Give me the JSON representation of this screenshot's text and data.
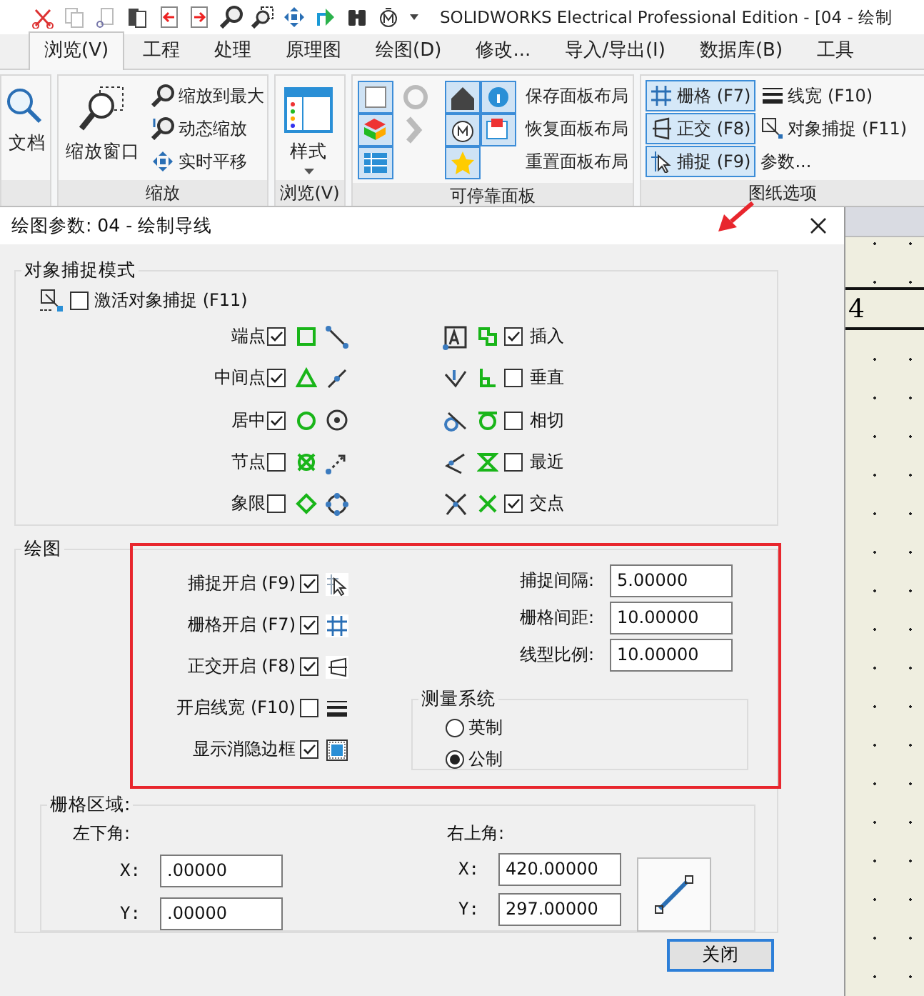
{
  "window": {
    "title": "SOLIDWORKS Electrical Professional Edition - [04 - 绘制"
  },
  "ribbon": {
    "tabs": [
      {
        "label": "浏览(V)",
        "selected": true
      },
      {
        "label": "工程",
        "selected": false
      },
      {
        "label": "处理",
        "selected": false
      },
      {
        "label": "原理图",
        "selected": false
      },
      {
        "label": "绘图(D)",
        "selected": false
      },
      {
        "label": "修改...",
        "selected": false
      },
      {
        "label": "导入/导出(I)",
        "selected": false
      },
      {
        "label": "数据库(B)",
        "selected": false
      },
      {
        "label": "工具",
        "selected": false
      }
    ],
    "groups": [
      {
        "items": [
          {
            "kind": "large",
            "label": "文档"
          }
        ]
      },
      {
        "label": "缩放",
        "items": [
          {
            "kind": "large",
            "label": "缩放窗口"
          },
          {
            "kind": "small",
            "label": "缩放到最大"
          },
          {
            "kind": "small",
            "label": "动态缩放"
          },
          {
            "kind": "small",
            "label": "实时平移"
          }
        ]
      },
      {
        "label": "浏览(V)",
        "items": [
          {
            "kind": "large",
            "label": "样式",
            "dropdown": true
          }
        ]
      },
      {
        "label": "可停靠面板",
        "items": [
          {
            "kind": "icon_grid"
          },
          {
            "kind": "small",
            "label": "保存面板布局"
          },
          {
            "kind": "small",
            "label": "恢复面板布局"
          },
          {
            "kind": "small",
            "label": "重置面板布局"
          }
        ]
      },
      {
        "label": "图纸选项",
        "items": [
          {
            "kind": "toggle",
            "label": "栅格 (F7)",
            "on": true
          },
          {
            "kind": "toggle",
            "label": "正交 (F8)",
            "on": true
          },
          {
            "kind": "toggle",
            "label": "捕捉 (F9)",
            "on": true
          },
          {
            "kind": "small",
            "label": "线宽 (F10)"
          },
          {
            "kind": "small",
            "label": "对象捕捉 (F11)"
          },
          {
            "kind": "small",
            "label": "参数..."
          }
        ]
      }
    ]
  },
  "dialog": {
    "title": "绘图参数: 04 - 绘制导线",
    "object_snap": {
      "title": "对象捕捉模式",
      "activate": {
        "label": "激活对象捕捉 (F11)",
        "checked": false
      },
      "left_modes": [
        {
          "label": "端点",
          "checked": true
        },
        {
          "label": "中间点",
          "checked": true
        },
        {
          "label": "居中",
          "checked": true
        },
        {
          "label": "节点",
          "checked": false
        },
        {
          "label": "象限",
          "checked": false
        }
      ],
      "right_modes": [
        {
          "label": "插入",
          "checked": true
        },
        {
          "label": "垂直",
          "checked": false
        },
        {
          "label": "相切",
          "checked": false
        },
        {
          "label": "最近",
          "checked": false
        },
        {
          "label": "交点",
          "checked": true
        }
      ]
    },
    "drawing": {
      "title": "绘图",
      "toggles": [
        {
          "label": "捕捉开启 (F9)",
          "checked": true
        },
        {
          "label": "栅格开启 (F7)",
          "checked": true
        },
        {
          "label": "正交开启 (F8)",
          "checked": true
        },
        {
          "label": "开启线宽 (F10)",
          "checked": false
        },
        {
          "label": "显示消隐边框",
          "checked": true
        }
      ],
      "fields": [
        {
          "label": "捕捉间隔:",
          "value": "5.00000"
        },
        {
          "label": "栅格间距:",
          "value": "10.00000"
        },
        {
          "label": "线型比例:",
          "value": "10.00000"
        }
      ],
      "units": {
        "title": "测量系统",
        "options": [
          {
            "label": "英制",
            "selected": false
          },
          {
            "label": "公制",
            "selected": true
          }
        ]
      },
      "grid_area": {
        "title": "栅格区域:",
        "lower_left": {
          "title": "左下角:",
          "x": {
            "label": "X:",
            "value": ".00000"
          },
          "y": {
            "label": "Y:",
            "value": ".00000"
          }
        },
        "upper_right": {
          "title": "右上角:",
          "x": {
            "label": "X:",
            "value": "420.00000"
          },
          "y": {
            "label": "Y:",
            "value": "297.00000"
          }
        }
      }
    },
    "close_button": "关闭"
  },
  "background_drawing": {
    "visible_text": "4"
  }
}
